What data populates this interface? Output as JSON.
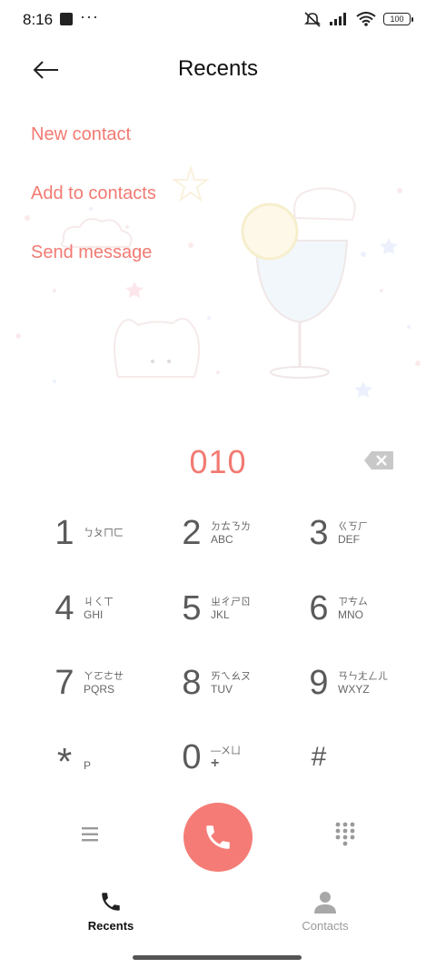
{
  "status_bar": {
    "time": "8:16",
    "overflow": "···",
    "battery": "100",
    "icons": [
      "app-square-icon",
      "mute-icon",
      "signal-icon",
      "wifi-icon",
      "battery-icon"
    ]
  },
  "header": {
    "title": "Recents",
    "back_icon": "arrow-left-icon"
  },
  "menu": {
    "new_contact": "New contact",
    "add_to_contacts": "Add to contacts",
    "send_message": "Send message"
  },
  "dialer": {
    "number": "010",
    "backspace_icon": "backspace-icon"
  },
  "keys": [
    {
      "digit": "1",
      "zhuyin": "ㄅㄆㄇㄈ",
      "letters": ""
    },
    {
      "digit": "2",
      "zhuyin": "ㄉㄊㄋㄌ",
      "letters": "ABC"
    },
    {
      "digit": "3",
      "zhuyin": "ㄍㄎㄏ",
      "letters": "DEF"
    },
    {
      "digit": "4",
      "zhuyin": "ㄐㄑㄒ",
      "letters": "GHI"
    },
    {
      "digit": "5",
      "zhuyin": "ㄓㄔㄕㄖ",
      "letters": "JKL"
    },
    {
      "digit": "6",
      "zhuyin": "ㄗㄘㄙ",
      "letters": "MNO"
    },
    {
      "digit": "7",
      "zhuyin": "ㄚㄛㄜㄝ",
      "letters": "PQRS"
    },
    {
      "digit": "8",
      "zhuyin": "ㄞㄟㄠㄡ",
      "letters": "TUV"
    },
    {
      "digit": "9",
      "zhuyin": "ㄢㄣㄤㄥㄦ",
      "letters": "WXYZ"
    },
    {
      "digit": "*",
      "zhuyin": "",
      "letters": "P"
    },
    {
      "digit": "0",
      "zhuyin": "—ㄨㄩ",
      "letters": "+"
    },
    {
      "digit": "#",
      "zhuyin": "",
      "letters": ""
    }
  ],
  "actions": {
    "menu_icon": "menu-icon",
    "call_icon": "phone-icon",
    "dialpad_icon": "dialpad-icon"
  },
  "nav": {
    "recents": "Recents",
    "contacts": "Contacts"
  },
  "colors": {
    "accent": "#f27a73",
    "call_button": "#f57c76"
  }
}
